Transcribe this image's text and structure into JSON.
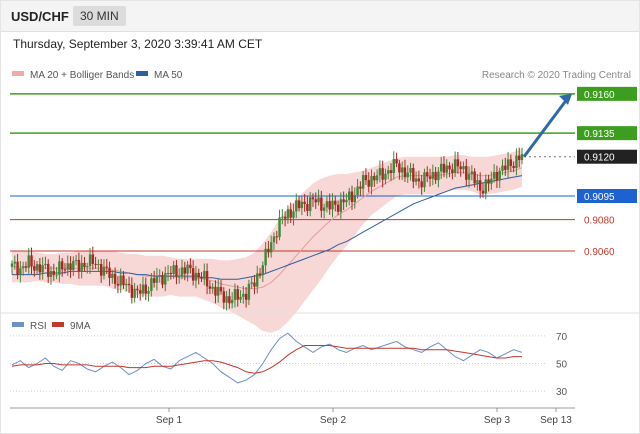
{
  "header": {
    "symbol": "USD/CHF",
    "timeframe": "30 MIN",
    "datetime": "Thursday, September 3, 2020 3:39:41 AM CET"
  },
  "legend": {
    "bollinger": "MA 20 + Bolliger Bands",
    "ma50": "MA 50",
    "credit": "Research © 2020 Trading Central"
  },
  "rsi_legend": {
    "rsi": "RSI",
    "ma": "9MA"
  },
  "colors": {
    "up": "#3a8a3a",
    "down": "#b22222",
    "band": "#f6c9c9",
    "ma20": "#e89a9a",
    "ma50": "#2e5f9e",
    "green": "#3c9e1e",
    "red": "#c0392b",
    "blue": "#1e62d0",
    "dark": "#222222",
    "arrow": "#2e6aa8"
  },
  "chart_data": [
    {
      "type": "line",
      "title": "USD/CHF",
      "ylim": [
        0.9025,
        0.9165
      ],
      "x_ticks": [
        "Sep 1",
        "Sep 2",
        "Sep 3",
        "Sep 13"
      ],
      "levels": [
        {
          "value": 0.916,
          "label": "0.9160",
          "style": "green"
        },
        {
          "value": 0.9135,
          "label": "0.9135",
          "style": "green"
        },
        {
          "value": 0.912,
          "label": "0.9120",
          "style": "current"
        },
        {
          "value": 0.9095,
          "label": "0.9095",
          "style": "blue"
        },
        {
          "value": 0.908,
          "label": "0.9080",
          "style": "red"
        },
        {
          "value": 0.906,
          "label": "0.9060",
          "style": "red"
        }
      ],
      "price_path": [
        0.905,
        0.9049,
        0.9052,
        0.905,
        0.9048,
        0.9046,
        0.9049,
        0.9052,
        0.905,
        0.9053,
        0.9052,
        0.9048,
        0.9043,
        0.904,
        0.9037,
        0.9033,
        0.9036,
        0.9041,
        0.9044,
        0.9046,
        0.9047,
        0.9048,
        0.9045,
        0.9042,
        0.9036,
        0.9032,
        0.9029,
        0.9031,
        0.9033,
        0.904,
        0.9052,
        0.9065,
        0.9078,
        0.9084,
        0.9088,
        0.909,
        0.9092,
        0.909,
        0.9088,
        0.909,
        0.9092,
        0.9097,
        0.9104,
        0.9106,
        0.9108,
        0.9111,
        0.9115,
        0.911,
        0.9107,
        0.9104,
        0.9108,
        0.911,
        0.9113,
        0.9114,
        0.9112,
        0.9107,
        0.91,
        0.9103,
        0.911,
        0.9113,
        0.9117,
        0.912
      ],
      "ma20": [
        0.905,
        0.905,
        0.905,
        0.905,
        0.9049,
        0.9049,
        0.9049,
        0.9049,
        0.9049,
        0.9049,
        0.9049,
        0.9049,
        0.9048,
        0.9047,
        0.9046,
        0.9045,
        0.9044,
        0.9044,
        0.9044,
        0.9044,
        0.9043,
        0.9043,
        0.9043,
        0.9042,
        0.9041,
        0.9039,
        0.9038,
        0.9037,
        0.9036,
        0.9036,
        0.9037,
        0.904,
        0.9045,
        0.9051,
        0.9057,
        0.9063,
        0.9069,
        0.9074,
        0.9079,
        0.9083,
        0.9086,
        0.909,
        0.9094,
        0.9098,
        0.9101,
        0.9104,
        0.9107,
        0.9108,
        0.9108,
        0.9108,
        0.9108,
        0.9108,
        0.9109,
        0.911,
        0.911,
        0.9109,
        0.9108,
        0.9108,
        0.9109,
        0.911,
        0.9111,
        0.9113
      ],
      "ma50": [
        0.9045,
        0.9045,
        0.9045,
        0.9045,
        0.9046,
        0.9046,
        0.9046,
        0.9047,
        0.9047,
        0.9047,
        0.9047,
        0.9047,
        0.9047,
        0.9046,
        0.9046,
        0.9045,
        0.9045,
        0.9044,
        0.9044,
        0.9044,
        0.9044,
        0.9044,
        0.9044,
        0.9043,
        0.9043,
        0.9042,
        0.9042,
        0.9042,
        0.9043,
        0.9044,
        0.9045,
        0.9047,
        0.9049,
        0.9051,
        0.9053,
        0.9055,
        0.9057,
        0.9059,
        0.9061,
        0.9064,
        0.9066,
        0.9069,
        0.9072,
        0.9075,
        0.9078,
        0.9081,
        0.9084,
        0.9087,
        0.909,
        0.9092,
        0.9094,
        0.9096,
        0.9098,
        0.91,
        0.9101,
        0.9102,
        0.9103,
        0.9104,
        0.9105,
        0.9106,
        0.9107,
        0.9108
      ],
      "band_width": [
        0.001,
        0.001,
        0.001,
        0.0009,
        0.0009,
        0.0009,
        0.001,
        0.001,
        0.0011,
        0.0011,
        0.0011,
        0.0011,
        0.0012,
        0.0012,
        0.0012,
        0.0013,
        0.0013,
        0.0013,
        0.0013,
        0.0012,
        0.0012,
        0.0012,
        0.0012,
        0.0013,
        0.0014,
        0.0015,
        0.0016,
        0.0018,
        0.002,
        0.0023,
        0.0028,
        0.0032,
        0.0035,
        0.0036,
        0.0036,
        0.0035,
        0.0034,
        0.0032,
        0.0029,
        0.0026,
        0.0023,
        0.002,
        0.0017,
        0.0015,
        0.0014,
        0.0013,
        0.0012,
        0.0012,
        0.0012,
        0.0012,
        0.0012,
        0.0012,
        0.0011,
        0.0011,
        0.0011,
        0.0011,
        0.0012,
        0.0012,
        0.0012,
        0.0012,
        0.0012,
        0.0012
      ],
      "projection_target": 0.916
    },
    {
      "type": "line",
      "title": "RSI",
      "ylim": [
        20,
        80
      ],
      "y_ticks": [
        70,
        50,
        30
      ],
      "series": [
        {
          "name": "RSI",
          "values": [
            49,
            52,
            47,
            50,
            54,
            48,
            45,
            52,
            50,
            46,
            44,
            48,
            51,
            47,
            42,
            45,
            50,
            53,
            48,
            46,
            52,
            55,
            58,
            54,
            50,
            44,
            40,
            36,
            38,
            42,
            50,
            60,
            68,
            72,
            66,
            62,
            58,
            62,
            64,
            60,
            58,
            61,
            63,
            60,
            62,
            64,
            66,
            62,
            60,
            58,
            62,
            65,
            60,
            55,
            52,
            56,
            60,
            58,
            54,
            57,
            60,
            58
          ]
        },
        {
          "name": "9MA",
          "values": [
            48,
            49,
            49,
            49,
            50,
            50,
            49,
            49,
            49,
            49,
            48,
            48,
            48,
            48,
            47,
            47,
            47,
            48,
            48,
            48,
            49,
            50,
            51,
            52,
            52,
            51,
            49,
            47,
            44,
            43,
            44,
            47,
            51,
            56,
            60,
            63,
            63,
            63,
            63,
            62,
            61,
            61,
            61,
            61,
            61,
            61,
            61,
            61,
            61,
            60,
            60,
            60,
            60,
            59,
            58,
            57,
            56,
            55,
            54,
            54,
            55,
            55
          ]
        }
      ]
    }
  ]
}
